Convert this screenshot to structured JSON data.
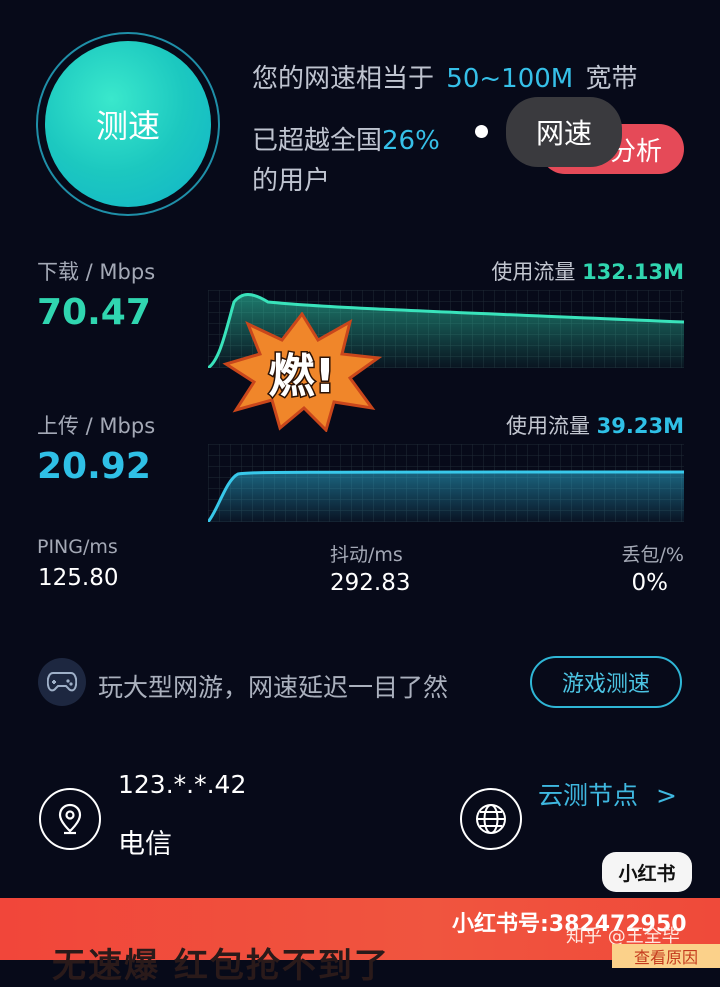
{
  "speed_test": {
    "button_label": "测速"
  },
  "summary": {
    "line1_prefix": "您的网速相当于",
    "broadband_range": "50~100M",
    "line1_suffix": "宽带",
    "line2_prefix": "已超越全国",
    "percent": "26%",
    "line3": "的用户"
  },
  "analyze_button": {
    "label": "分析"
  },
  "tooltip": {
    "label": "网速"
  },
  "download": {
    "label": "下载 / Mbps",
    "value": "70.47",
    "usage_label": "使用流量",
    "usage_value": "132.13M",
    "color": "#30d6b0"
  },
  "upload": {
    "label": "上传 / Mbps",
    "value": "20.92",
    "usage_label": "使用流量",
    "usage_value": "39.23M",
    "color": "#2fc0e6"
  },
  "sticker": {
    "text": "燃!"
  },
  "stats": {
    "ping_label": "PING/ms",
    "ping_value": "125.80",
    "jitter_label": "抖动/ms",
    "jitter_value": "292.83",
    "loss_label": "丢包/%",
    "loss_value": "0%"
  },
  "game": {
    "icon": "gamepad-icon",
    "text": "玩大型网游，网速延迟一目了然",
    "button_label": "游戏测速"
  },
  "network": {
    "location_icon": "location-pin-icon",
    "ip": "123.*.*.42",
    "isp": "电信",
    "globe_icon": "globe-icon",
    "cloud_nodes_label": "云测节点",
    "chevron": ">"
  },
  "watermark": {
    "xhs_badge": "小红书"
  },
  "banner": {
    "id_text": "小红书号:382472950",
    "zhihu_text": "知乎 @王全毕",
    "big_text": "无速爆 红包抢不到了",
    "tag_text": "查看原因"
  }
}
